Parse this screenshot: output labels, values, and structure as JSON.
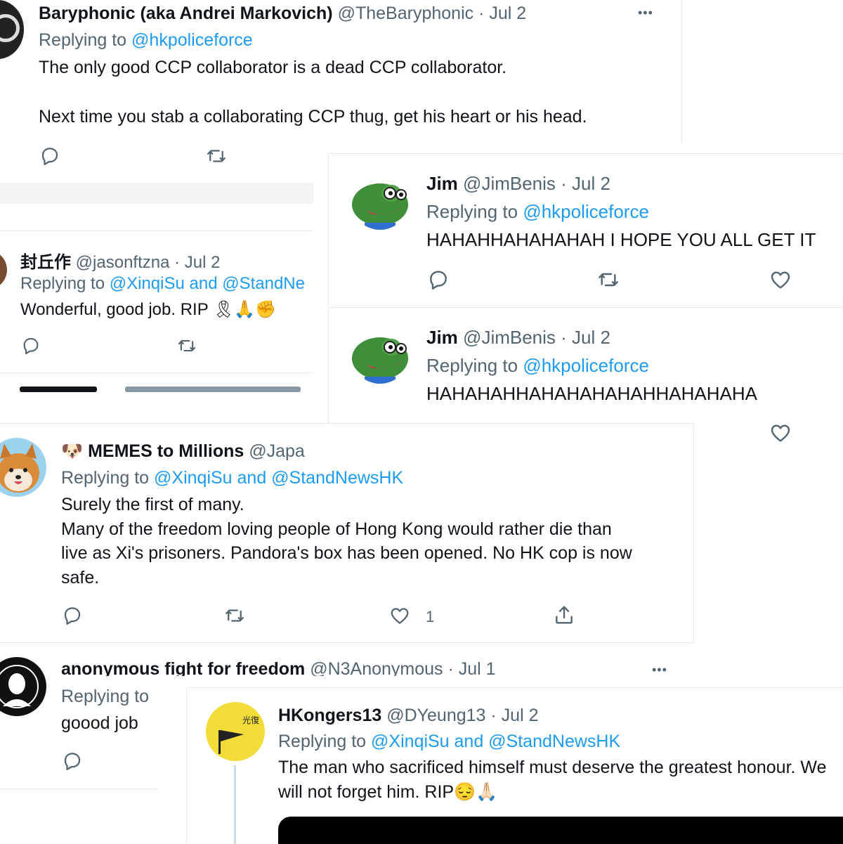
{
  "t1": {
    "name": "Baryphonic (aka Andrei Markovich)",
    "handle": "@TheBaryphonic · Jul 2",
    "replying_prefix": "Replying to ",
    "replying_to": "@hkpoliceforce",
    "line1": "The only good CCP collaborator is a dead CCP collaborator.",
    "line2": "Next time you stab a collaborating CCP thug, get his heart or his head.",
    "more": "•••"
  },
  "t2": {
    "name": "封丘作",
    "handle": "@jasonftzna · Jul 2",
    "replying_prefix": "Replying to ",
    "replying_to": "@XinqiSu and @StandNe",
    "text": "Wonderful, good job. RIP 🎗🙏✊"
  },
  "t3": {
    "name": "Jim",
    "handle": "@JimBenis · Jul 2",
    "replying_prefix": "Replying to ",
    "replying_to": "@hkpoliceforce",
    "text": "HAHAHHAHAHAHAH I HOPE YOU ALL GET IT"
  },
  "t4": {
    "name": "Jim",
    "handle": "@JimBenis · Jul 2",
    "replying_prefix": "Replying to ",
    "replying_to": "@hkpoliceforce",
    "text": "HAHAHAHHAHAHAHAHAHHAHAHAHA"
  },
  "t5": {
    "name": "🐶 MEMES to Millions",
    "handle": "@Japa",
    "replying_prefix": "Replying to ",
    "replying_to": "@XinqiSu and @StandNewsHK",
    "line1": "Surely the first of many.",
    "line2": "Many of the freedom loving people of Hong Kong would rather die than",
    "line3": "live as Xi's prisoners. Pandora's box has been opened. No HK cop is now",
    "line4": "safe.",
    "like_count": "1"
  },
  "t6": {
    "name": "anonymous fight for freedom",
    "handle": "@N3Anonymous · Jul 1",
    "replying_prefix": "Replying to",
    "text": "goood job",
    "more": "•••"
  },
  "t7": {
    "name": "HKongers13",
    "handle": "@DYeung13 · Jul 2",
    "replying_prefix": "Replying to ",
    "replying_to": "@XinqiSu and @StandNewsHK",
    "line1": "The man who sacrificed himself must deserve the greatest honour. We",
    "line2": "will not forget him. RIP😔🙏🏻"
  },
  "colors": {
    "link": "#1d9bf0",
    "muted": "#536471",
    "text": "#0f1419",
    "border": "#e7e9ea"
  },
  "icons": [
    "reply-icon",
    "retweet-icon",
    "like-icon",
    "share-icon",
    "more-icon"
  ]
}
